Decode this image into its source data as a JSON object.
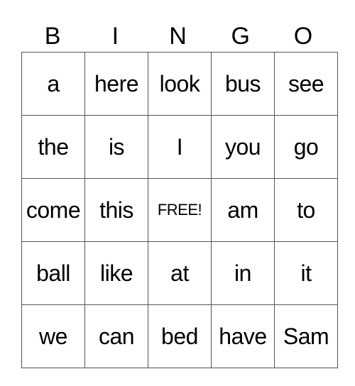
{
  "header": [
    "B",
    "I",
    "N",
    "G",
    "O"
  ],
  "rows": [
    [
      "a",
      "here",
      "look",
      "bus",
      "see"
    ],
    [
      "the",
      "is",
      "I",
      "you",
      "go"
    ],
    [
      "come",
      "this",
      "FREE!",
      "am",
      "to"
    ],
    [
      "ball",
      "like",
      "at",
      "in",
      "it"
    ],
    [
      "we",
      "can",
      "bed",
      "have",
      "Sam"
    ]
  ]
}
